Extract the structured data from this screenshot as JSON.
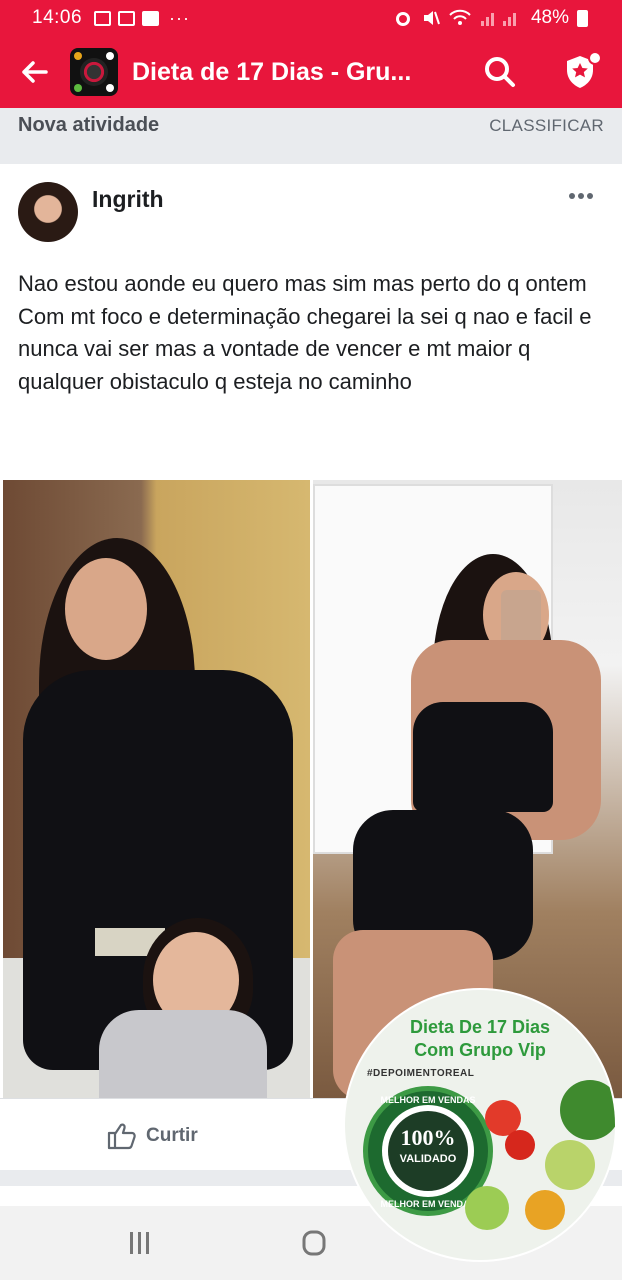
{
  "status_bar": {
    "time": "14:06",
    "battery": "48%",
    "more": "···"
  },
  "app_bar": {
    "title": "Dieta de 17 Dias - Gru..."
  },
  "feed": {
    "sort_label": "Nova atividade",
    "sort_button": "CLASSIFICAR"
  },
  "post": {
    "author": "Ingrith",
    "text_lines": [
      "Nao estou aonde eu quero mas sim mas perto do q ontem",
      "Com mt foco e determinação chegarei la sei q nao e facil e nunca vai ser mas a vontade de vencer e mt maior q qualquer obistaculo q esteja no caminho"
    ],
    "like_label": "Curtir"
  },
  "badge": {
    "title_line1": "Dieta De 17 Dias",
    "title_line2": "Com Grupo Vip",
    "hashtag": "#DEPOIMENTOREAL",
    "seal_top": "MELHOR EM VENDAS",
    "seal_number": "100%",
    "seal_sub": "VALIDADO",
    "seal_bottom": "MELHOR EM VENDAS"
  },
  "colors": {
    "brand": "#e8163c",
    "feed_bg": "#e9ebee",
    "green": "#2e9a3c"
  }
}
